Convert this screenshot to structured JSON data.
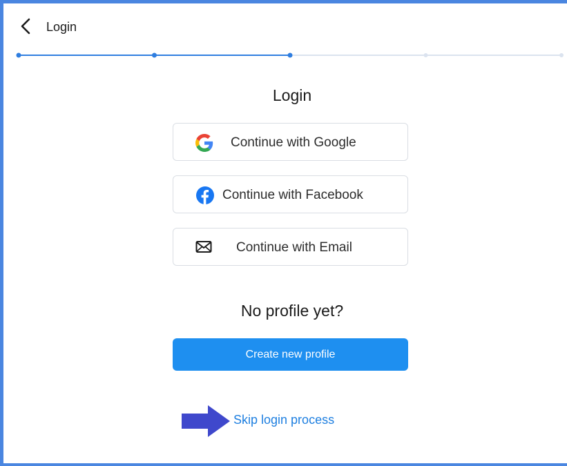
{
  "header": {
    "title": "Login"
  },
  "progress": {
    "total_steps": 5,
    "current_step": 3
  },
  "login": {
    "heading": "Login",
    "buttons": [
      {
        "label": "Continue with Google",
        "icon": "google-icon"
      },
      {
        "label": "Continue with Facebook",
        "icon": "facebook-icon"
      },
      {
        "label": "Continue with Email",
        "icon": "mail-icon"
      }
    ]
  },
  "signup": {
    "prompt": "No profile yet?",
    "create_label": "Create new profile"
  },
  "skip": {
    "label": "Skip login process",
    "arrow_icon": "arrow-right-icon"
  },
  "colors": {
    "accent": "#1e8ff0",
    "progress_active": "#2f7ee0",
    "progress_inactive": "#dbe3ef",
    "frame": "#4a86e0",
    "arrow": "#3f48cc",
    "link": "#1e7fe0"
  }
}
